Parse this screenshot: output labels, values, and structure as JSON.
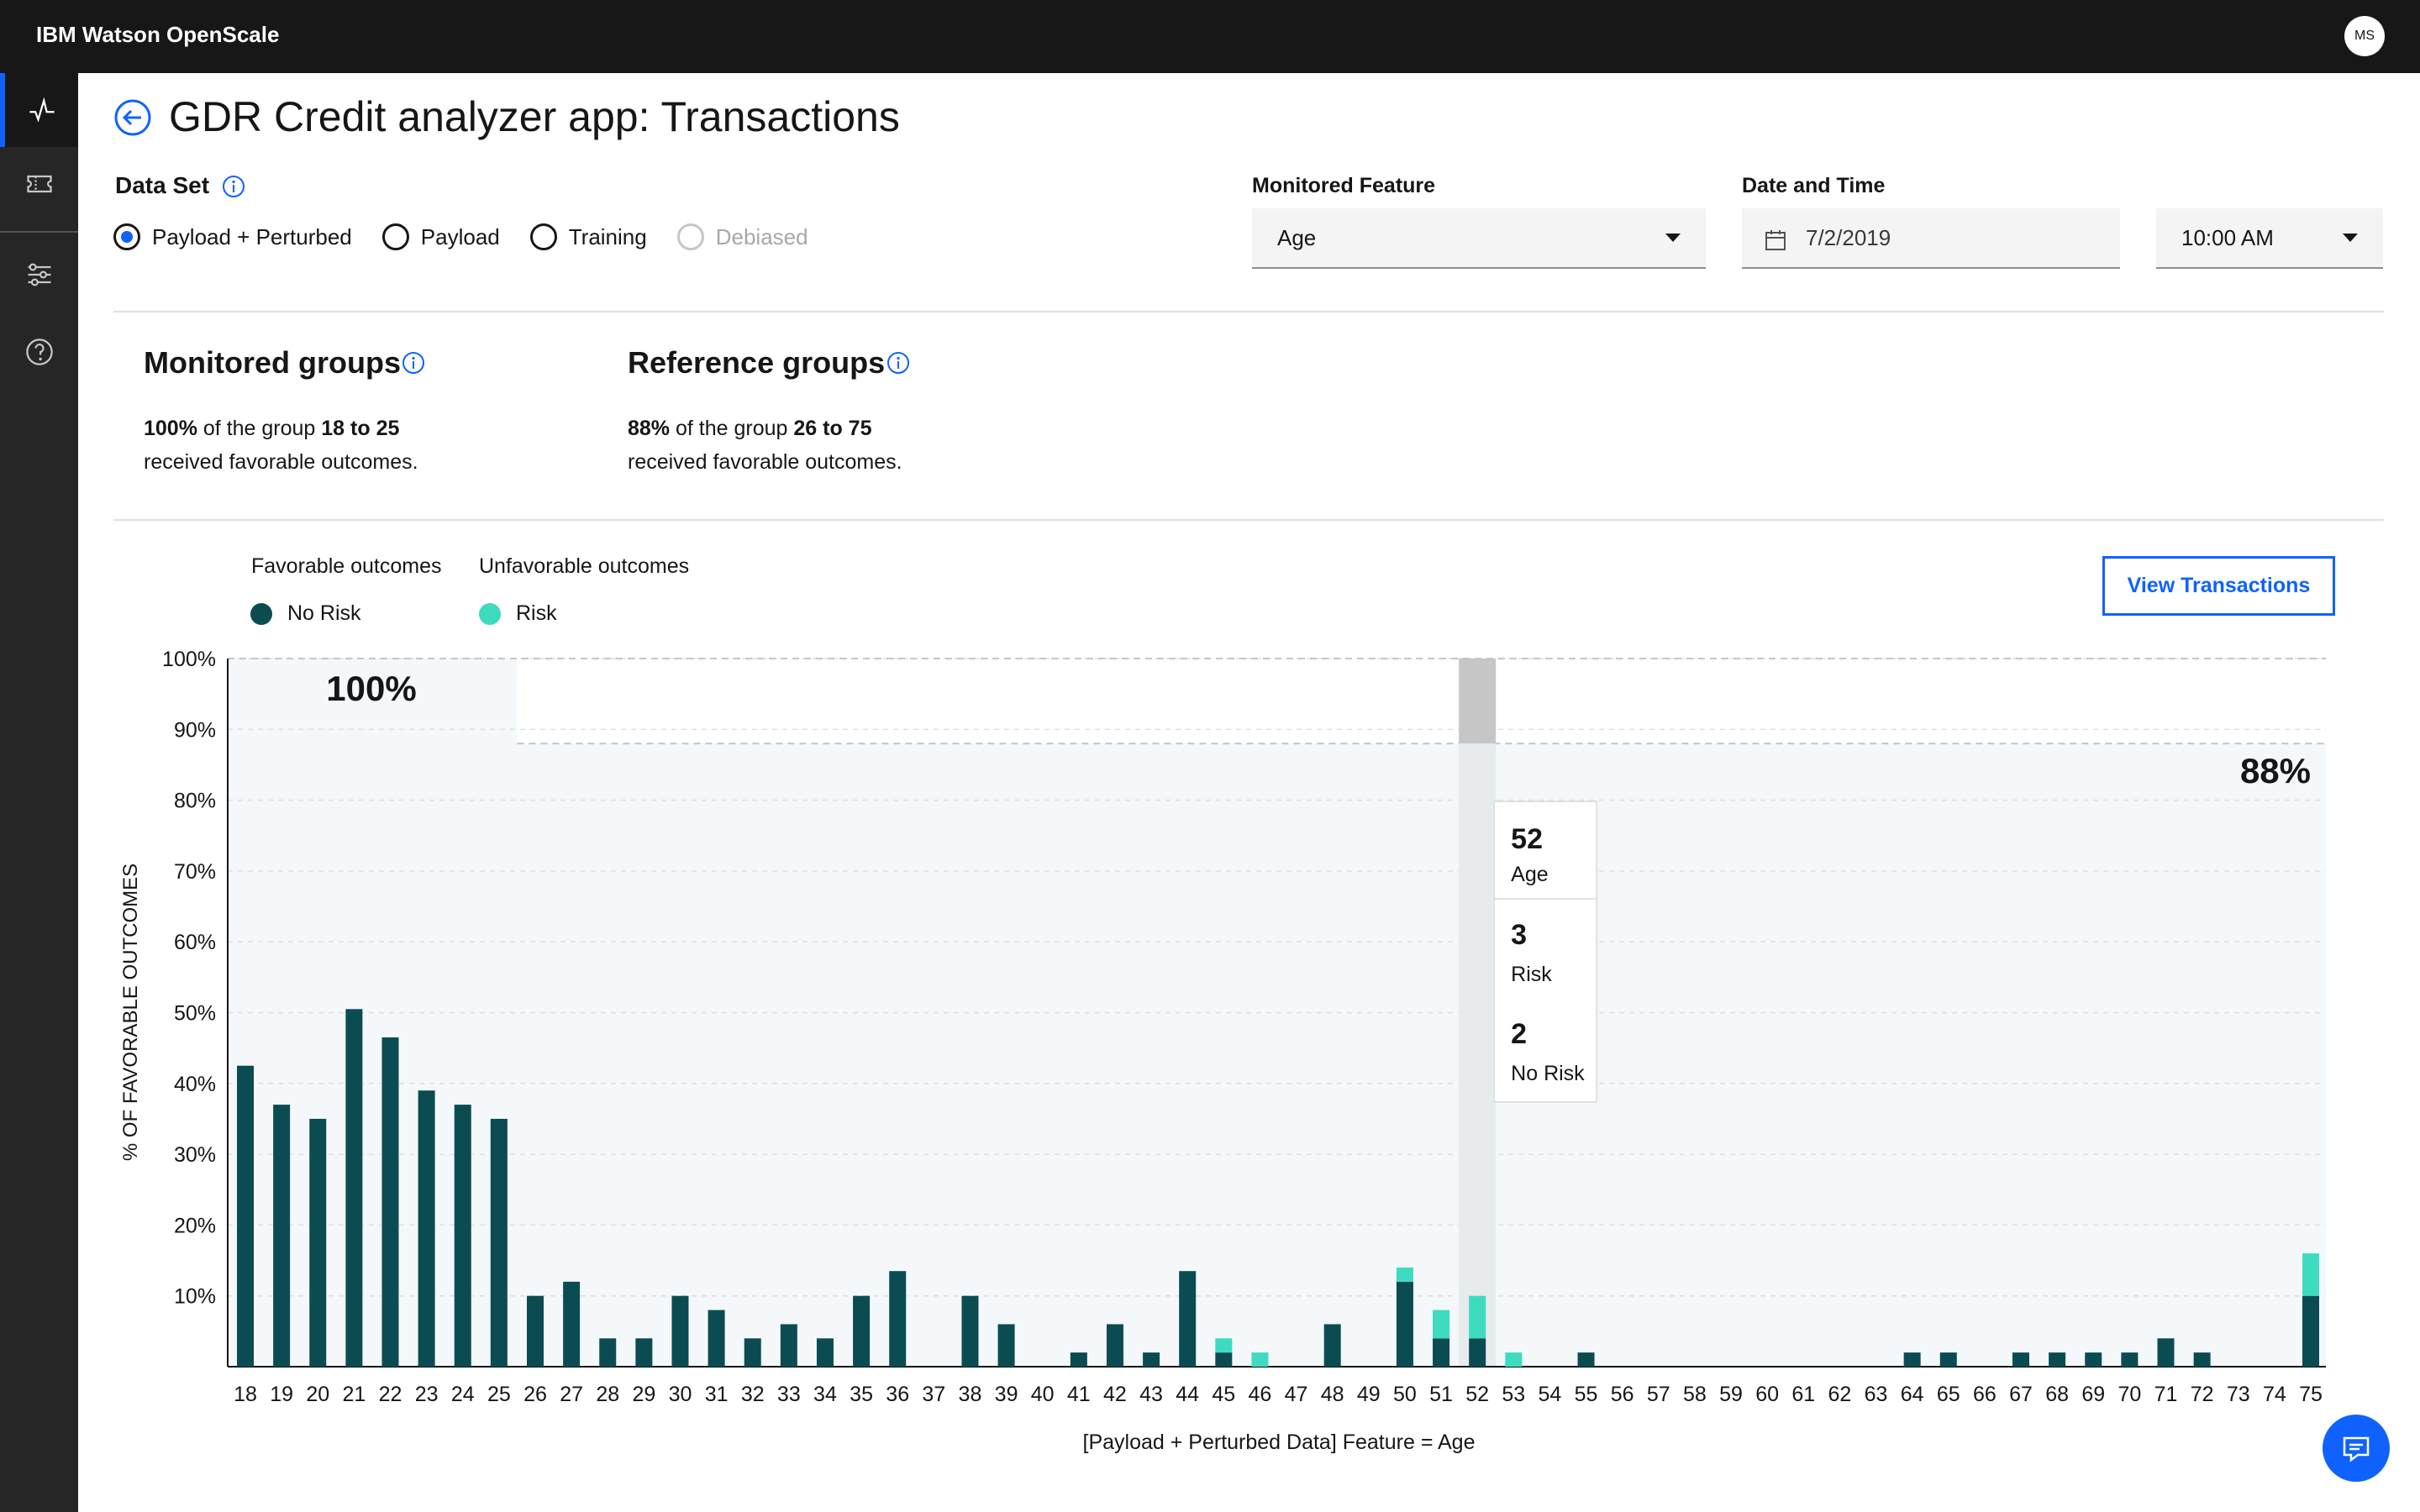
{
  "header": {
    "brand_prefix": "IBM",
    "brand_name": "Watson OpenScale",
    "avatar_initials": "MS"
  },
  "sidenav": {
    "items": [
      {
        "name": "monitor",
        "icon": "pulse-icon",
        "active": true
      },
      {
        "name": "deployments",
        "icon": "ticket-icon",
        "active": false
      },
      {
        "name": "configure",
        "icon": "sliders-icon",
        "active": false
      },
      {
        "name": "help",
        "icon": "help-icon",
        "active": false
      }
    ]
  },
  "page": {
    "title": "GDR Credit analyzer app: Transactions"
  },
  "dataset": {
    "label": "Data Set",
    "options": [
      {
        "label": "Payload + Perturbed",
        "selected": true,
        "disabled": false
      },
      {
        "label": "Payload",
        "selected": false,
        "disabled": false
      },
      {
        "label": "Training",
        "selected": false,
        "disabled": false
      },
      {
        "label": "Debiased",
        "selected": false,
        "disabled": true
      }
    ]
  },
  "monitored_feature": {
    "label": "Monitored Feature",
    "value": "Age"
  },
  "date_time": {
    "label": "Date and Time",
    "date": "7/2/2019",
    "time": "10:00 AM"
  },
  "monitored_groups": {
    "title": "Monitored groups",
    "pct": "100%",
    "text1": " of the group ",
    "range": "18 to 25",
    "text2": "received favorable outcomes."
  },
  "reference_groups": {
    "title": "Reference groups",
    "pct": "88%",
    "text1": " of the group ",
    "range": "26 to 75",
    "text2": "received favorable outcomes."
  },
  "legend": {
    "favorable_head": "Favorable outcomes",
    "unfavorable_head": "Unfavorable outcomes",
    "no_risk": "No Risk",
    "risk": "Risk"
  },
  "view_button": "View Transactions",
  "tooltip": {
    "age": "52",
    "age_label": "Age",
    "risk": "3",
    "risk_label": "Risk",
    "no_risk": "2",
    "no_risk_label": "No Risk"
  },
  "colors": {
    "no_risk": "#0b4c53",
    "risk": "#3ddbc0",
    "accent": "#0f62fe",
    "band": "#f4f8fb"
  },
  "chart_data": {
    "type": "bar",
    "stacked": true,
    "ylabel": "% OF FAVORABLE OUTCOMES",
    "xlabel": "[Payload + Perturbed Data] Feature = Age",
    "ylim": [
      0,
      100
    ],
    "yticks": [
      "10%",
      "20%",
      "30%",
      "40%",
      "50%",
      "60%",
      "70%",
      "80%",
      "90%",
      "100%"
    ],
    "categories": [
      "18",
      "19",
      "20",
      "21",
      "22",
      "23",
      "24",
      "25",
      "26",
      "27",
      "28",
      "29",
      "30",
      "31",
      "32",
      "33",
      "34",
      "35",
      "36",
      "37",
      "38",
      "39",
      "40",
      "41",
      "42",
      "43",
      "44",
      "45",
      "46",
      "47",
      "48",
      "49",
      "50",
      "51",
      "52",
      "53",
      "54",
      "55",
      "56",
      "57",
      "58",
      "59",
      "60",
      "61",
      "62",
      "63",
      "64",
      "65",
      "66",
      "67",
      "68",
      "69",
      "70",
      "71",
      "72",
      "73",
      "74",
      "75"
    ],
    "series": [
      {
        "name": "No Risk",
        "values": [
          42.5,
          37,
          35,
          50.5,
          46.5,
          39,
          37,
          35,
          10,
          12,
          4,
          4,
          10,
          8,
          4,
          6,
          4,
          10,
          13.5,
          0,
          10,
          6,
          0,
          2,
          6,
          2,
          13.5,
          2,
          0,
          0,
          6,
          0,
          12,
          4,
          4,
          0,
          0,
          2,
          0,
          0,
          0,
          0,
          0,
          0,
          0,
          0,
          2,
          2,
          0,
          2,
          2,
          2,
          2,
          4,
          2,
          0,
          0,
          10
        ]
      },
      {
        "name": "Risk",
        "values": [
          0,
          0,
          0,
          0,
          0,
          0,
          0,
          0,
          0,
          0,
          0,
          0,
          0,
          0,
          0,
          0,
          0,
          0,
          0,
          0,
          0,
          0,
          0,
          0,
          0,
          0,
          0,
          2,
          2,
          0,
          0,
          0,
          2,
          4,
          6,
          2,
          0,
          0,
          0,
          0,
          0,
          0,
          0,
          0,
          0,
          0,
          0,
          0,
          0,
          0,
          0,
          0,
          0,
          0,
          0,
          0,
          0,
          6
        ]
      }
    ],
    "monitored_range": [
      "18",
      "25"
    ],
    "reference_range": [
      "26",
      "75"
    ],
    "monitored_pct_label": "100%",
    "reference_pct_label": "88%",
    "monitored_pct": 100,
    "reference_pct": 88,
    "highlight": "52"
  }
}
